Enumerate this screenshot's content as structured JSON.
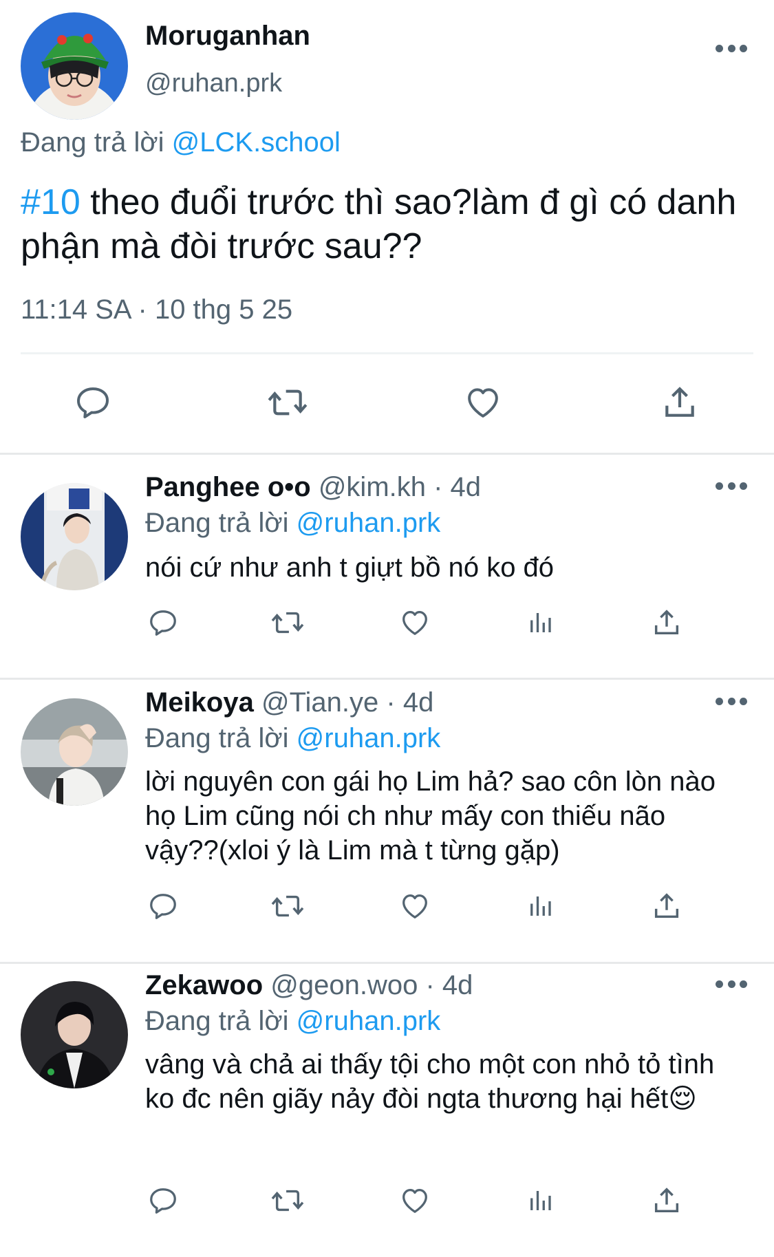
{
  "main_tweet": {
    "display_name": "Moruganhan",
    "handle": "@ruhan.prk",
    "replying_prefix": "Đang trả lời",
    "replying_to": "@LCK.school",
    "hashtag": "#10",
    "body": " theo đuổi trước thì sao?làm đ gì có danh phận mà đòi trước sau??",
    "timestamp": "11:14 SA · 10 thg 5 25",
    "avatar_icon": "avatar-green-hat",
    "actions": [
      "reply-icon",
      "retweet-icon",
      "like-icon",
      "share-icon"
    ]
  },
  "replies": [
    {
      "display_name": "Panghee o•o",
      "handle": "@kim.kh · 4d",
      "replying_prefix": "Đang trả lời",
      "replying_to": "@ruhan.prk",
      "text": "nói cứ như anh t giựt bồ nó ko đó",
      "avatar_icon": "avatar-white-hoodie"
    },
    {
      "display_name": "Meikoya",
      "handle": "@Tian.ye · 4d",
      "replying_prefix": "Đang trả lời",
      "replying_to": "@ruhan.prk",
      "text": "lời nguyên con gái họ Lim hả? sao côn lòn nào họ Lim cũng nói ch như mấy con thiếu não vậy??(xloi ý là Lim mà t từng gặp)",
      "avatar_icon": "avatar-street"
    },
    {
      "display_name": "Zekawoo",
      "handle": "@geon.woo · 4d",
      "replying_prefix": "Đang trả lời",
      "replying_to": "@ruhan.prk",
      "text": "vâng và chả ai thấy tội cho một con nhỏ tỏ tình ko đc nên giãy nảy đòi ngta thương hại hết😌",
      "avatar_icon": "avatar-dark-jacket"
    }
  ],
  "colors": {
    "link": "#1d9bf0",
    "secondary_text": "#536471",
    "primary_text": "#0f1419",
    "divider": "#e7e9ea"
  }
}
